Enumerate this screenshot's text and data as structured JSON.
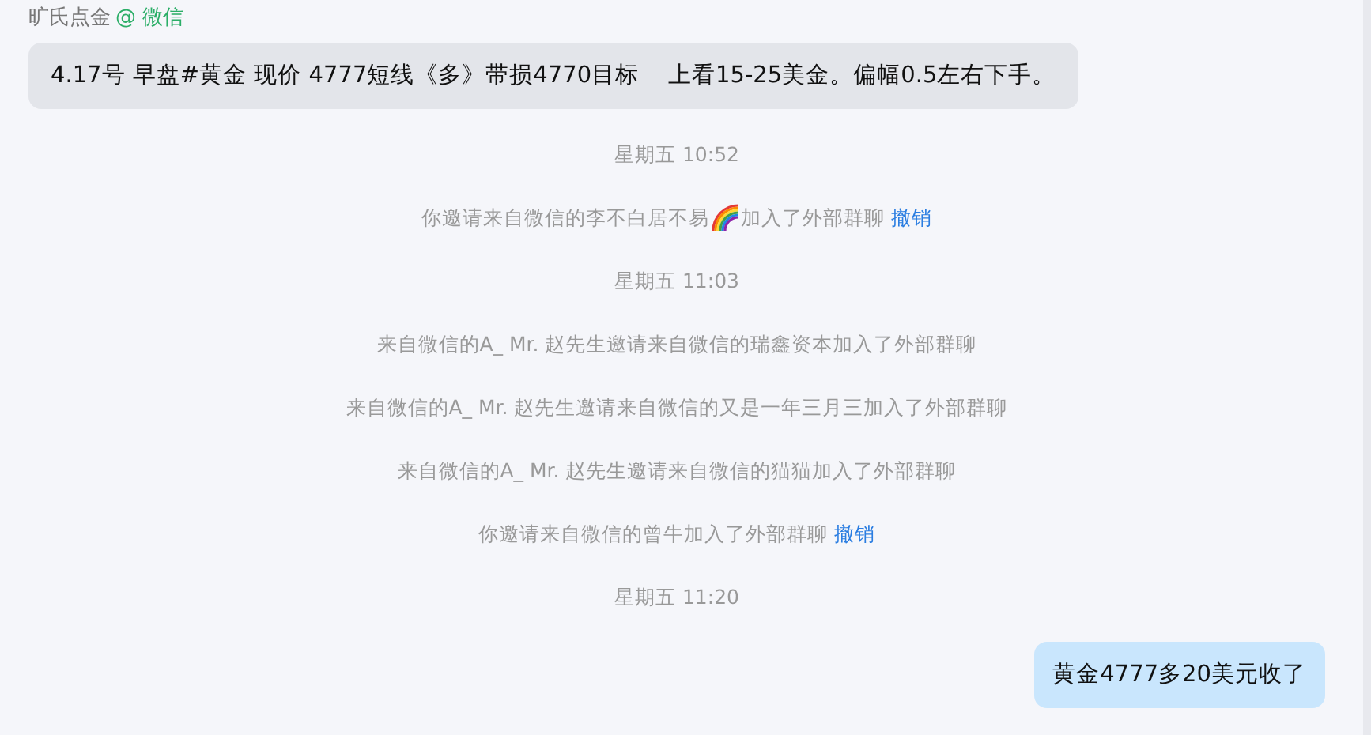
{
  "sender": {
    "name": "旷氏点金",
    "source": "@ 微信"
  },
  "incoming": {
    "text": "4.17号 早盘#黄金 现价 4777短线《多》带损4770目标    上看15-25美金。偏幅0.5左右下手。"
  },
  "events": [
    {
      "kind": "time",
      "text": "星期五 10:52"
    },
    {
      "kind": "notice",
      "parts": [
        {
          "kind": "text",
          "text": "你邀请来自微信的李不白居不易"
        },
        {
          "kind": "emoji"
        },
        {
          "kind": "text",
          "text": "加入了外部群聊"
        }
      ],
      "link": "撤销"
    },
    {
      "kind": "time",
      "text": "星期五 11:03"
    },
    {
      "kind": "notice",
      "parts": [
        {
          "kind": "text",
          "text": "来自微信的A_ Mr. 赵先生邀请来自微信的瑞鑫资本加入了外部群聊"
        }
      ]
    },
    {
      "kind": "notice",
      "parts": [
        {
          "kind": "text",
          "text": "来自微信的A_ Mr. 赵先生邀请来自微信的又是一年三月三加入了外部群聊"
        }
      ]
    },
    {
      "kind": "notice",
      "parts": [
        {
          "kind": "text",
          "text": "来自微信的A_ Mr. 赵先生邀请来自微信的猫猫加入了外部群聊"
        }
      ]
    },
    {
      "kind": "notice",
      "parts": [
        {
          "kind": "text",
          "text": "你邀请来自微信的曾牛加入了外部群聊"
        }
      ],
      "link": "撤销"
    },
    {
      "kind": "time",
      "text": "星期五 11:20"
    }
  ],
  "outgoing": {
    "text": "黄金4777多20美元收了"
  }
}
